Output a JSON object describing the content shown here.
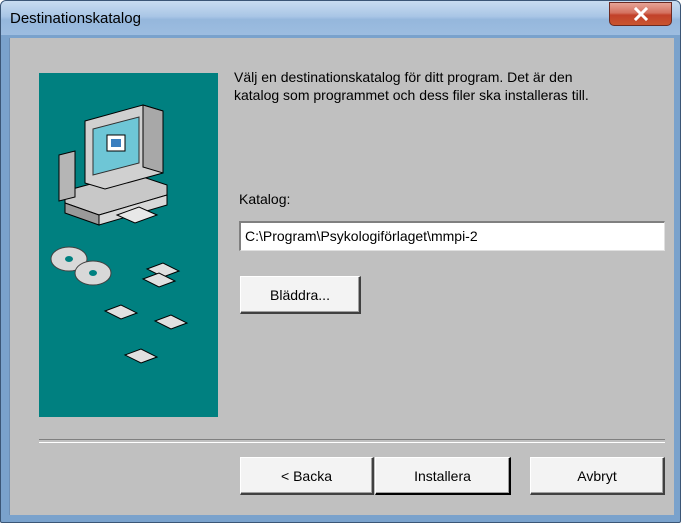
{
  "window": {
    "title": "Destinationskatalog",
    "close_icon": "close-icon"
  },
  "content": {
    "description_line1": "Välj en destinationskatalog för ditt program. Det är den",
    "description_line2": "katalog som programmet och dess filer ska installeras till.",
    "katalog_label": "Katalog:",
    "path_value": "C:\\Program\\Psykologiförlaget\\mmpi-2",
    "browse_label": "Bläddra..."
  },
  "footer": {
    "back_label": "< Backa",
    "install_label": "Installera",
    "cancel_label": "Avbryt"
  },
  "colors": {
    "illustration_bg": "#008080",
    "dialog_bg": "#c0c0c0",
    "close_button": "#c9452e"
  }
}
